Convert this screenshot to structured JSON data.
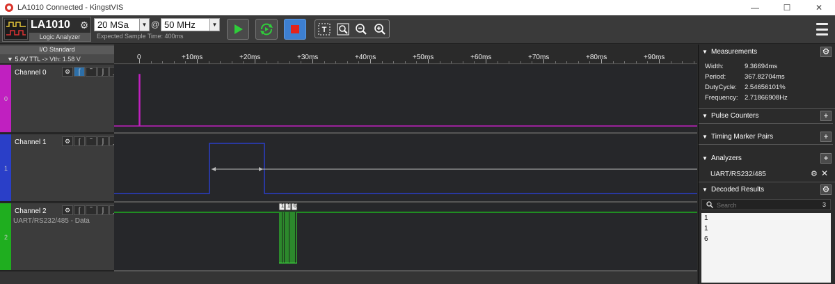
{
  "window": {
    "title": "LA1010 Connected - KingstVIS",
    "minimize": "—",
    "maximize": "☐",
    "close": "✕"
  },
  "toolbar": {
    "device_name": "LA1010",
    "device_subtitle": "Logic Analyzer",
    "sample_count": "20 MSa",
    "at": "@",
    "sample_rate": "50 MHz",
    "expected_time": "Expected Sample Time: 400ms",
    "start_icon": "play-icon",
    "repeat_icon": "repeat-play-icon",
    "stop_icon": "stop-icon",
    "zoom_icons": [
      "text-cursor-icon",
      "zoom-fit-icon",
      "zoom-out-icon",
      "zoom-in-icon"
    ],
    "menu_icon": "hamburger-icon"
  },
  "io": {
    "title": "I/O Standard",
    "standard": "5.0V TTL",
    "vth": "-> Vth: 1.58 V"
  },
  "ruler": {
    "labels": [
      "0",
      "+10ms",
      "+20ms",
      "+30ms",
      "+40ms",
      "+50ms",
      "+60ms",
      "+70ms",
      "+80ms",
      "+90ms"
    ]
  },
  "channels": [
    {
      "index": "0",
      "name": "Channel 0",
      "desc": "",
      "color": "#c020c0"
    },
    {
      "index": "1",
      "name": "Channel 1",
      "desc": "",
      "color": "#2a3fc8"
    },
    {
      "index": "2",
      "name": "Channel 2",
      "desc": "UART/RS232/485 - Data",
      "color": "#1fae1f"
    }
  ],
  "channel_tools": [
    "gear-icon",
    "trigger-rising-edge-icon",
    "trigger-high-icon",
    "trigger-falling-edge-icon",
    "trigger-low-icon"
  ],
  "decode_labels": [
    "1",
    "1",
    "6"
  ],
  "panel": {
    "measurements": {
      "title": "Measurements",
      "rows": [
        {
          "label": "Width:",
          "value": "9.36694ms"
        },
        {
          "label": "Period:",
          "value": "367.82704ms"
        },
        {
          "label": "DutyCycle:",
          "value": "2.54656101%"
        },
        {
          "label": "Frequency:",
          "value": "2.71866908Hz"
        }
      ]
    },
    "pulse_counters": {
      "title": "Pulse Counters"
    },
    "timing_markers": {
      "title": "Timing Marker Pairs"
    },
    "analyzers": {
      "title": "Analyzers",
      "item": "UART/RS232/485"
    },
    "decoded": {
      "title": "Decoded Results",
      "search_placeholder": "Search",
      "count": "3",
      "results": [
        "1",
        "1",
        "6"
      ]
    }
  }
}
